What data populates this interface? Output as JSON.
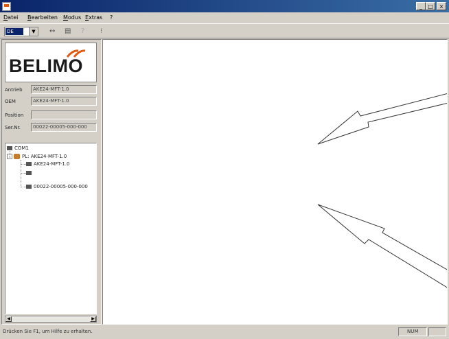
{
  "titlebar": {
    "buttons": [
      "_",
      "□",
      "×"
    ]
  },
  "menu": {
    "items": [
      "Datei",
      "Bearbeiten",
      "Modus",
      "Extras",
      "?"
    ]
  },
  "toolbar": {
    "language_value": "DE",
    "icons": [
      "dropdown-arrow-icon",
      "connect-icon",
      "print-icon",
      "help-icon",
      "separator-icon"
    ]
  },
  "logo": {
    "text": "BELIMO"
  },
  "fields": [
    {
      "label": "Antrieb",
      "value": "AKE24-MFT-1.0"
    },
    {
      "label": "OEM",
      "value": "AKE24-MFT-1.0"
    },
    {
      "label": "Position",
      "value": ""
    },
    {
      "label": "Ser.Nr.",
      "value": "00022-00005-000-000"
    }
  ],
  "tree": {
    "root": "COM1",
    "device": "PL: AKE24-MFT-1.0",
    "children": [
      "AKE24-MFT-1.0",
      "",
      "00022-00005-000-000"
    ]
  },
  "status": {
    "text": "Drücken Sie F1, um Hilfe zu erhalten.",
    "mode": "NUM"
  },
  "colors": {
    "title_start": "#0a246a",
    "title_end": "#3a6ea5",
    "logo_accent": "#e05a10",
    "window_bg": "#d4d0c8"
  }
}
